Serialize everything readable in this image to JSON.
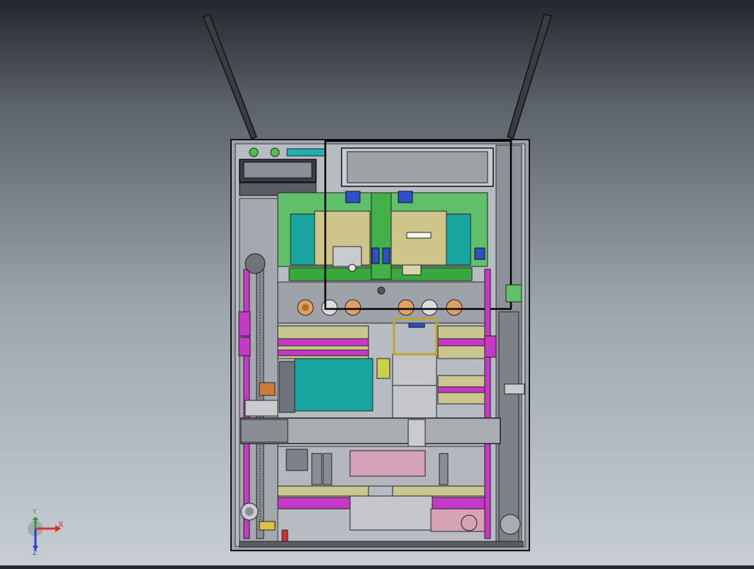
{
  "viewport": {
    "background_top": "#23272d",
    "background_bottom": "#c7cdd3"
  },
  "model": {
    "frame_color": "#1a1a1a",
    "panel_colors": {
      "green_plate": "#5fbf6a",
      "teal_block": "#1aa6a0",
      "tan_block": "#cfc58a",
      "magenta_rail": "#c638c6",
      "pink_block": "#d6a2b5",
      "steel": "#a9acb3",
      "dark_steel": "#6e737b",
      "blue_part": "#2f4fc8",
      "orange_part": "#d07a3a",
      "olive_strip": "#c9c68f"
    }
  },
  "triad": {
    "x_label": "X",
    "y_label": "Y",
    "z_label": "Z",
    "x_color": "#e03030",
    "y_color": "#2fa02f",
    "z_color": "#3040d0"
  }
}
